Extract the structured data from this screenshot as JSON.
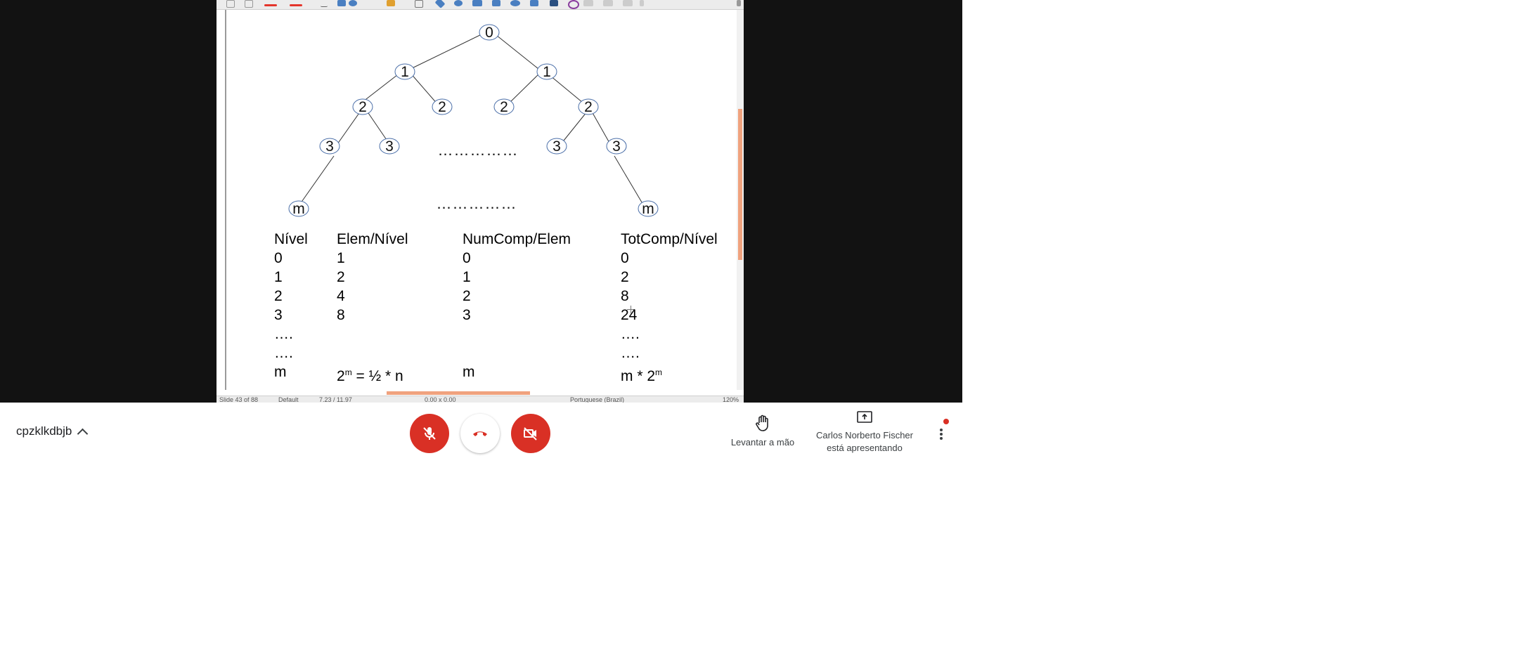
{
  "slide": {
    "tree": {
      "root": "0",
      "level1": [
        "1",
        "1"
      ],
      "level2": [
        "2",
        "2",
        "2",
        "2"
      ],
      "level3": [
        "3",
        "3",
        "3",
        "3"
      ],
      "leaf": [
        "m",
        "m"
      ],
      "ellipsis_1": "……………",
      "ellipsis_2": "……………"
    },
    "table": {
      "headers": [
        "Nível",
        "Elem/Nível",
        "NumComp/Elem",
        "TotComp/Nível"
      ],
      "rows": [
        [
          "0",
          "1",
          "0",
          "0"
        ],
        [
          "1",
          "2",
          "1",
          "2"
        ],
        [
          "2",
          "4",
          "2",
          "8"
        ],
        [
          "3",
          "8",
          "3",
          "24"
        ],
        [
          "….",
          "",
          "",
          "…."
        ],
        [
          "….",
          "",
          "",
          "…."
        ]
      ],
      "last_row": {
        "level": "m",
        "elem_base": "2",
        "elem_exp": "m",
        "elem_rest": " = ½ * n",
        "numcomp": "m",
        "totcomp_base": "m * 2",
        "totcomp_exp": "m"
      }
    },
    "statusbar": {
      "slide": "Slide 43 of 88",
      "layout": "Default",
      "position": "7.23 / 11.97",
      "size": "0.00 x 0.00",
      "language": "Portuguese (Brazil)",
      "zoom": "120%"
    }
  },
  "meet": {
    "meeting_code": "cpzklkdbjb",
    "raise_hand_label": "Levantar a mão",
    "presenting_line1": "Carlos Norberto Fischer",
    "presenting_line2": "está apresentando"
  },
  "colors": {
    "danger": "#d93025",
    "accent_orange": "#f0a27e",
    "stage_bg": "#121212"
  }
}
